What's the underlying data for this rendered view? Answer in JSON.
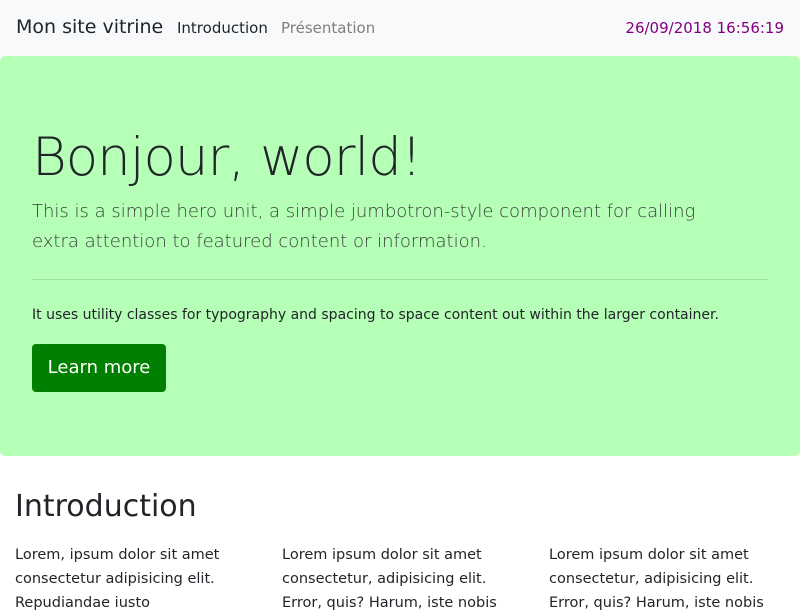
{
  "navbar": {
    "brand": "Mon site vitrine",
    "links": [
      {
        "label": "Introduction",
        "active": true
      },
      {
        "label": "Présentation",
        "active": false
      }
    ],
    "datetime": "26/09/2018 16:56:19"
  },
  "hero": {
    "title": "Bonjour, world!",
    "lead": "This is a simple hero unit, a simple jumbotron-style component for calling extra attention to featured content or information.",
    "body": "It uses utility classes for typography and spacing to space content out within the larger container.",
    "button_label": "Learn more"
  },
  "intro": {
    "title": "Introduction",
    "columns": [
      {
        "text": "Lorem, ipsum dolor sit amet consectetur adipisicing elit. Repudiandae iusto"
      },
      {
        "text": "Lorem ipsum dolor sit amet consectetur, adipisicing elit. Error, quis? Harum, iste nobis"
      },
      {
        "text": "Lorem ipsum dolor sit amet consectetur, adipisicing elit. Error, quis? Harum, iste nobis"
      }
    ]
  },
  "colors": {
    "navbar_bg": "#f8f9fa",
    "hero_bg": "#b6ffb6",
    "button_bg": "#008000",
    "clock_text": "#800080"
  }
}
